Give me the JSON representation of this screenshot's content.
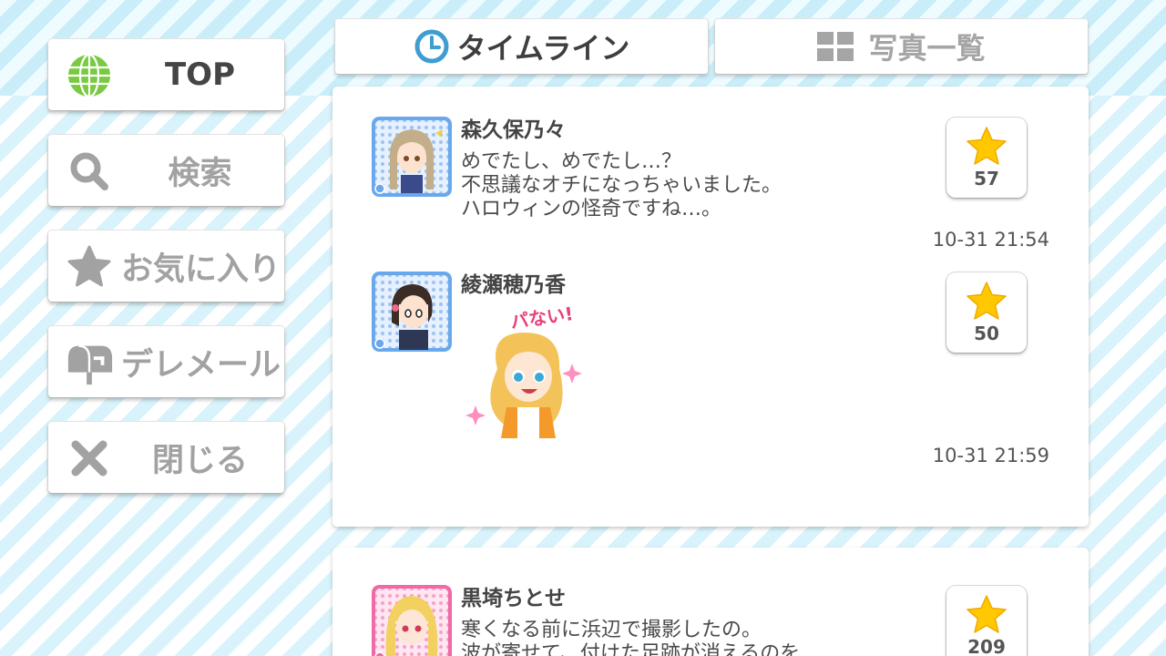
{
  "sidebar": {
    "items": [
      {
        "label": "TOP",
        "icon": "globe-icon",
        "active": true
      },
      {
        "label": "検索",
        "icon": "search-icon"
      },
      {
        "label": "お気に入り",
        "icon": "star-icon"
      },
      {
        "label": "デレメール",
        "icon": "mailbox-icon"
      },
      {
        "label": "閉じる",
        "icon": "close-icon"
      }
    ]
  },
  "tabs": [
    {
      "label": "タイムライン",
      "icon": "clock-icon",
      "active": true
    },
    {
      "label": "写真一覧",
      "icon": "grid-icon",
      "active": false
    }
  ],
  "posts": [
    {
      "author": "森久保乃々",
      "lines": [
        "めでたし、めでたし…？",
        "不思議なオチになっちゃいました。",
        "ハロウィンの怪奇ですね…。"
      ],
      "likes": "57",
      "time": "10-31 21:54"
    },
    {
      "author": "綾瀬穂乃香",
      "stamp_text": "パない!",
      "likes": "50",
      "time": "10-31 21:59"
    },
    {
      "author": "黒埼ちとせ",
      "lines": [
        "寒くなる前に浜辺で撮影したの。",
        "波が寄せて、付けた足跡が消えるのを"
      ],
      "likes": "209"
    }
  ],
  "colors": {
    "stripe_light": "#d8f3fb",
    "accent_blue": "#3f9dd0",
    "star_yellow": "#ffc800",
    "globe_green": "#7ac943",
    "avatar_blue": "#6aa8ec",
    "avatar_pink": "#f06aa8"
  }
}
